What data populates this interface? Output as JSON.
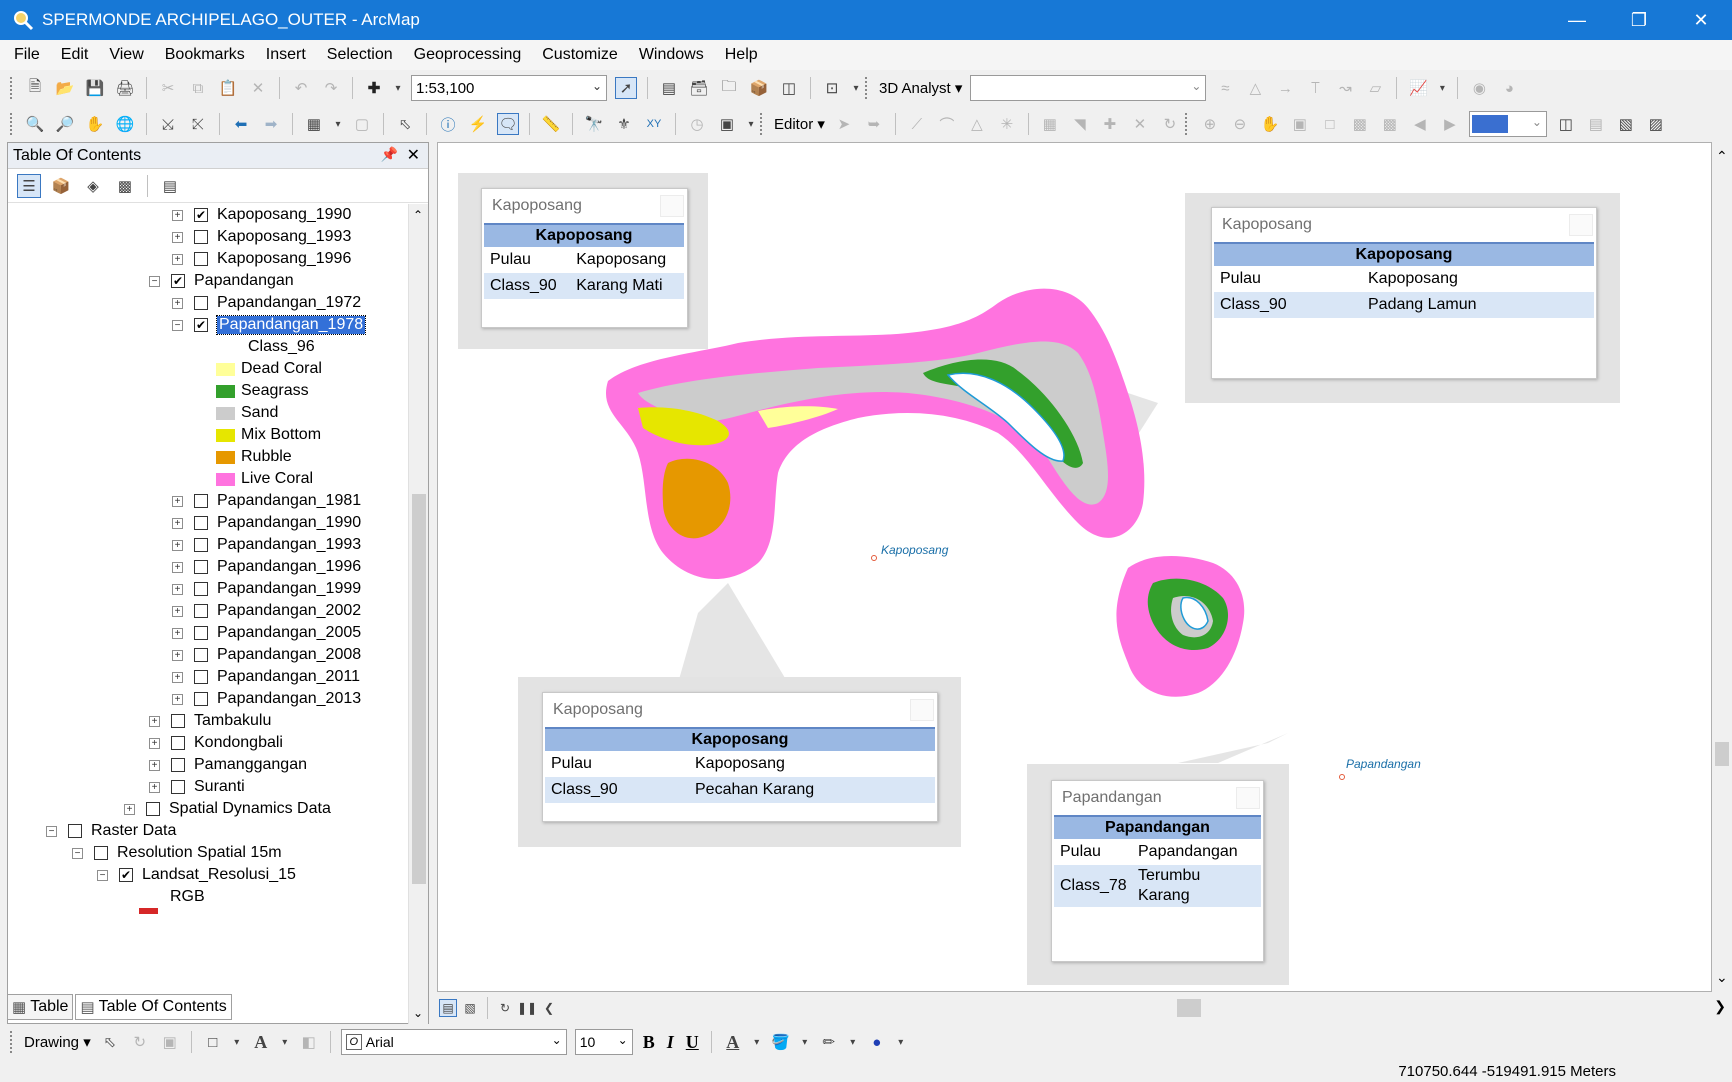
{
  "window": {
    "title": "SPERMONDE ARCHIPELAGO_OUTER - ArcMap"
  },
  "menu": [
    "File",
    "Edit",
    "View",
    "Bookmarks",
    "Insert",
    "Selection",
    "Geoprocessing",
    "Customize",
    "Windows",
    "Help"
  ],
  "toolbar": {
    "scale": "1:53,100",
    "analyst_label": "3D Analyst",
    "editor_label": "Editor"
  },
  "toc": {
    "title": "Table Of Contents",
    "items": [
      {
        "label": "Kapoposang_1990",
        "checked": true
      },
      {
        "label": "Kapoposang_1993",
        "checked": false
      },
      {
        "label": "Kapoposang_1996",
        "checked": false
      },
      {
        "label": "Papandangan",
        "checked": true
      },
      {
        "label": "Papandangan_1972",
        "checked": false
      },
      {
        "label": "Papandangan_1978",
        "checked": true
      },
      {
        "label": "Class_96"
      },
      {
        "label": "Dead Coral",
        "color": "#ffff99"
      },
      {
        "label": "Seagrass",
        "color": "#33a02c"
      },
      {
        "label": "Sand",
        "color": "#cccccc"
      },
      {
        "label": "Mix Bottom",
        "color": "#e6e600"
      },
      {
        "label": "Rubble",
        "color": "#e69800"
      },
      {
        "label": "Live Coral",
        "color": "#ff73df"
      },
      {
        "label": "Papandangan_1981",
        "checked": false
      },
      {
        "label": "Papandangan_1990",
        "checked": false
      },
      {
        "label": "Papandangan_1993",
        "checked": false
      },
      {
        "label": "Papandangan_1996",
        "checked": false
      },
      {
        "label": "Papandangan_1999",
        "checked": false
      },
      {
        "label": "Papandangan_2002",
        "checked": false
      },
      {
        "label": "Papandangan_2005",
        "checked": false
      },
      {
        "label": "Papandangan_2008",
        "checked": false
      },
      {
        "label": "Papandangan_2011",
        "checked": false
      },
      {
        "label": "Papandangan_2013",
        "checked": false
      },
      {
        "label": "Tambakulu",
        "checked": false
      },
      {
        "label": "Kondongbali",
        "checked": false
      },
      {
        "label": "Pamanggangan",
        "checked": false
      },
      {
        "label": "Suranti",
        "checked": false
      },
      {
        "label": "Spatial Dynamics Data",
        "checked": false
      },
      {
        "label": "Raster Data",
        "checked": false
      },
      {
        "label": "Resolution Spatial 15m",
        "checked": false
      },
      {
        "label": "Landsat_Resolusi_15",
        "checked": true
      },
      {
        "label": "RGB"
      }
    ],
    "bottom_tabs": [
      "Table",
      "Table Of Contents"
    ]
  },
  "map": {
    "labels": {
      "kapoposang": "Kapoposang",
      "papandangan": "Papandangan"
    },
    "popups": [
      {
        "title": "Kapoposang",
        "header": "Kapoposang",
        "rows": [
          [
            "Pulau",
            "Kapoposang"
          ],
          [
            "Class_90",
            "Karang Mati"
          ]
        ]
      },
      {
        "title": "Kapoposang",
        "header": "Kapoposang",
        "rows": [
          [
            "Pulau",
            "Kapoposang"
          ],
          [
            "Class_90",
            "Padang Lamun"
          ]
        ]
      },
      {
        "title": "Kapoposang",
        "header": "Kapoposang",
        "rows": [
          [
            "Pulau",
            "Kapoposang"
          ],
          [
            "Class_90",
            "Pecahan Karang"
          ]
        ]
      },
      {
        "title": "Papandangan",
        "header": "Papandangan",
        "rows": [
          [
            "Pulau",
            "Papandangan"
          ],
          [
            "Class_78",
            "Terumbu Karang"
          ]
        ]
      }
    ]
  },
  "drawing": {
    "label": "Drawing",
    "font": "Arial",
    "size": "10"
  },
  "status": {
    "coords": "710750.644  -519491.915 Meters"
  }
}
